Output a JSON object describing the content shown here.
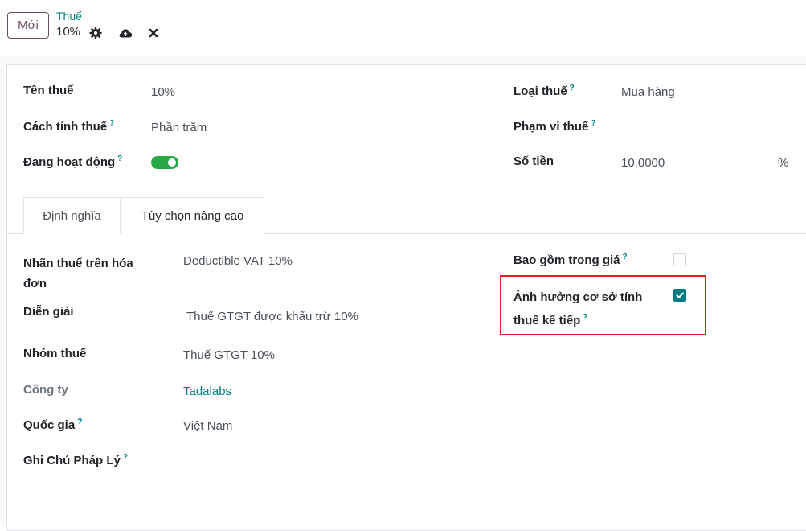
{
  "header": {
    "new_button": "Mới",
    "breadcrumb_parent": "Thuế",
    "breadcrumb_current": "10%",
    "icons": [
      "gear-icon",
      "cloud-upload-icon",
      "close-icon"
    ]
  },
  "form": {
    "tax_name": {
      "label": "Tên thuế",
      "value": "10%"
    },
    "tax_computation": {
      "label": "Cách tính thuế",
      "help": "?",
      "value": "Phần trăm"
    },
    "active": {
      "label": "Đang hoạt động",
      "help": "?",
      "value": true
    },
    "tax_type": {
      "label": "Loại thuế",
      "help": "?",
      "value": "Mua hàng"
    },
    "tax_scope": {
      "label": "Phạm vi thuế",
      "help": "?",
      "value": ""
    },
    "amount": {
      "label": "Số tiền",
      "value": "10,0000",
      "unit": "%"
    }
  },
  "tabs": [
    {
      "label": "Định nghĩa",
      "active": false
    },
    {
      "label": "Tùy chọn nâng cao",
      "active": true
    }
  ],
  "advanced": {
    "invoice_label": {
      "label_line1": "Nhãn thuế trên hóa",
      "label_line2": "đơn",
      "value": "Deductible VAT 10%"
    },
    "description": {
      "label": "Diễn giải",
      "value": "Thuế GTGT được khấu trừ 10%"
    },
    "tax_group": {
      "label": "Nhóm thuế",
      "value": "Thuế GTGT 10%"
    },
    "company": {
      "label": "Công ty",
      "value": "Tadalabs"
    },
    "country": {
      "label": "Quốc gia",
      "help": "?",
      "value": "Việt Nam"
    },
    "legal_notes": {
      "label": "Ghi Chú Pháp Lý",
      "help": "?",
      "value": ""
    },
    "price_include": {
      "label": "Bao gồm trong giá",
      "help": "?",
      "checked": false
    },
    "include_base_amount": {
      "label_line1": "Ảnh hưởng cơ sở tính",
      "label_line2": "thuế kế tiếp",
      "help": "?",
      "checked": true
    }
  },
  "colors": {
    "accent": "#017e84",
    "brand": "#714b67",
    "toggle_on": "#28a745",
    "highlight": "#e02020"
  }
}
